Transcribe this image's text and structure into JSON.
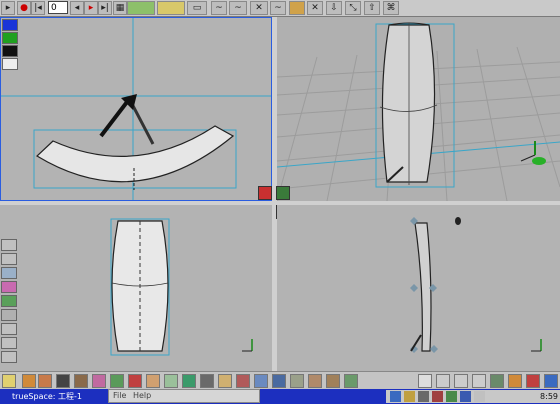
{
  "app": {
    "taskbar_title": "trueSpace: 工程-1",
    "menu": [
      "File",
      "Help"
    ]
  },
  "toolbar": {
    "frame_value": "0",
    "icons": [
      "select-arrow-icon",
      "record-icon",
      "rewind-icon",
      "play-back-icon",
      "play-icon",
      "fast-forward-icon",
      "grid-icon",
      "move-icon",
      "rotate-icon",
      "scale-icon",
      "link-icon",
      "unlink-icon",
      "object-tool-icon",
      "deform-icon",
      "sweep-icon",
      "lathe-icon",
      "material-icon",
      "render-icon",
      "up-arrow-icon",
      "settings-icon"
    ]
  },
  "palette": {
    "colors": [
      "#1a35d8",
      "#20a020",
      "#111111",
      "#ffffff"
    ]
  },
  "viewports": {
    "top_left": "top-view",
    "top_right": "perspective-view",
    "bottom_left": "front-view",
    "bottom_right": "side-view"
  },
  "status": {
    "clock": "8:59"
  },
  "accent": {
    "guide": "#3aa6c8",
    "selection": "#2a5de0",
    "grid": "#9c9c9c"
  }
}
